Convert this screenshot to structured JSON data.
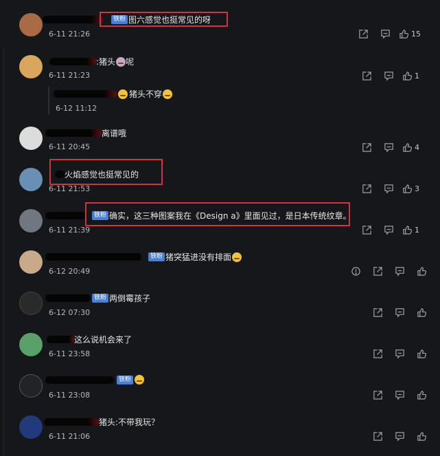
{
  "comments": [
    {
      "text": "图六感觉也挺常见的呀",
      "badge": "铁粉",
      "time": "6-11 21:26",
      "likes": "15",
      "avatar_color": "#a86b45"
    },
    {
      "text": "猪头",
      "text_after": "呢",
      "time": "6-11 21:23",
      "likes": "1",
      "avatar_color": "#d9a65b",
      "reply": {
        "text": "猪头不穿",
        "time": "6-12 11:12"
      }
    },
    {
      "text": "离谱哦",
      "time": "6-11 20:45",
      "likes": "4",
      "avatar_color": "#dcdcdc"
    },
    {
      "text": "火焰感觉也挺常见的",
      "time": "6-11 21:53",
      "likes": "3",
      "avatar_color": "#6a8fb4"
    },
    {
      "text": "确实，这三种图案我在《Design a》里面见过，是日本传统纹章。",
      "badge": "铁粉",
      "time": "6-11 21:39",
      "likes": "1",
      "avatar_color": "#6f7881"
    },
    {
      "text": "猪突猛进没有排面",
      "badge": "铁粉",
      "time": "6-12 20:49",
      "avatar_color": "#c8a98a"
    },
    {
      "text": "两倒霉孩子",
      "badge": "铁粉",
      "time": "6-12 07:30",
      "avatar_color": "#2a2a2a"
    },
    {
      "text": "这么说机会来了",
      "time": "6-11 23:58",
      "avatar_color": "#5aa06a"
    },
    {
      "text": "",
      "badge": "铁粉",
      "time": "6-11 23:08",
      "avatar_color": "#222326"
    },
    {
      "text": "猪头:不带我玩？",
      "time": "6-11 21:06",
      "avatar_color": "#233a7a"
    }
  ],
  "icons": [
    "share-icon",
    "reply-icon",
    "like-icon",
    "report-icon"
  ],
  "colors": {
    "background": "#16171b",
    "highlight": "#d3343b",
    "badge": "#4a7fd6"
  }
}
